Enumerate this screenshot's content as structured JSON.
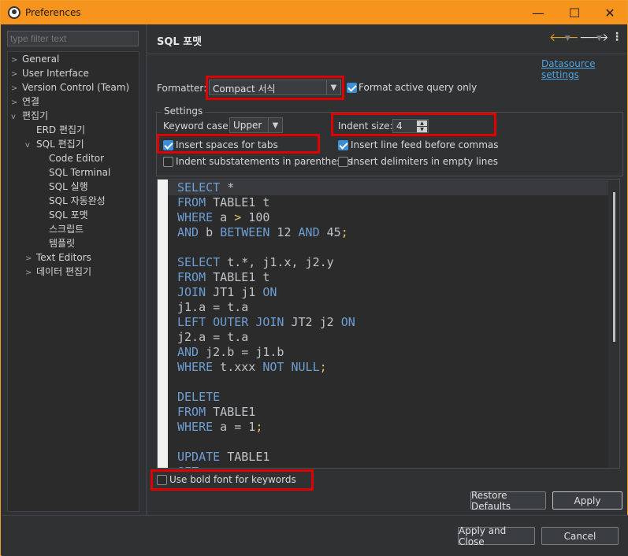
{
  "window": {
    "title": "Preferences",
    "minimize": "—",
    "maximize": "☐",
    "close": "✕"
  },
  "sidebar": {
    "filter_placeholder": "type filter text",
    "items": [
      {
        "label": "General",
        "arrow": ">"
      },
      {
        "label": "User Interface",
        "arrow": ">"
      },
      {
        "label": "Version Control (Team)",
        "arrow": ">"
      },
      {
        "label": "연결",
        "arrow": ">"
      },
      {
        "label": "편집기",
        "arrow": "v"
      },
      {
        "label": "ERD 편집기",
        "arrow": ""
      },
      {
        "label": "SQL 편집기",
        "arrow": "v"
      },
      {
        "label": "Code Editor",
        "arrow": ""
      },
      {
        "label": "SQL Terminal",
        "arrow": ""
      },
      {
        "label": "SQL 실행",
        "arrow": ""
      },
      {
        "label": "SQL 자동완성",
        "arrow": ""
      },
      {
        "label": "SQL 포맷",
        "arrow": ""
      },
      {
        "label": "스크립트",
        "arrow": ""
      },
      {
        "label": "템플릿",
        "arrow": ""
      },
      {
        "label": "Text Editors",
        "arrow": ">"
      },
      {
        "label": "데이터 편집기",
        "arrow": ">"
      }
    ]
  },
  "page": {
    "title": "SQL 포맷",
    "nav_back": "🡐",
    "nav_forward": "🡒",
    "nav_dropdown": "▼",
    "menu": "⋮",
    "datasource_link": "Datasource settings",
    "formatter_label": "Formatter:",
    "formatter_value": "Compact 서식",
    "format_active_label": "Format active query only",
    "settings_title": "Settings",
    "keyword_case_label": "Keyword case:",
    "keyword_case_value": "Upper",
    "indent_size_label": "Indent size:",
    "indent_size_value": "4",
    "insert_spaces_label": "Insert spaces for tabs",
    "insert_linefeed_label": "Insert line feed before commas",
    "indent_sub_label": "Indent substatements in parentheses",
    "insert_delims_label": "Insert delimiters in empty lines",
    "bold_font_label": "Use bold font for keywords",
    "restore_defaults": "Restore Defaults",
    "apply": "Apply"
  },
  "checkboxes": {
    "format_active": true,
    "insert_spaces": true,
    "insert_linefeed": true,
    "indent_sub": false,
    "insert_delims": false,
    "bold_font": false
  },
  "preview_lines": [
    [
      [
        "kw",
        "SELECT"
      ],
      [
        "txt",
        " *"
      ]
    ],
    [
      [
        "kw",
        "FROM"
      ],
      [
        "txt",
        " TABLE1 t"
      ]
    ],
    [
      [
        "kw",
        "WHERE"
      ],
      [
        "txt",
        " a "
      ],
      [
        "op",
        ">"
      ],
      [
        "txt",
        " 100"
      ]
    ],
    [
      [
        "kw",
        "AND"
      ],
      [
        "txt",
        " b "
      ],
      [
        "kw",
        "BETWEEN"
      ],
      [
        "txt",
        " 12 "
      ],
      [
        "kw",
        "AND"
      ],
      [
        "txt",
        " 45"
      ],
      [
        "op",
        ";"
      ]
    ],
    [],
    [
      [
        "kw",
        "SELECT"
      ],
      [
        "txt",
        " t.*, j1.x, j2.y"
      ]
    ],
    [
      [
        "kw",
        "FROM"
      ],
      [
        "txt",
        " TABLE1 t"
      ]
    ],
    [
      [
        "kw",
        "JOIN"
      ],
      [
        "txt",
        " JT1 j1 "
      ],
      [
        "kw",
        "ON"
      ]
    ],
    [
      [
        "txt",
        "j1.a = t.a"
      ]
    ],
    [
      [
        "kw",
        "LEFT OUTER JOIN"
      ],
      [
        "txt",
        " JT2 j2 "
      ],
      [
        "kw",
        "ON"
      ]
    ],
    [
      [
        "txt",
        "j2.a = t.a"
      ]
    ],
    [
      [
        "kw",
        "AND"
      ],
      [
        "txt",
        " j2.b = j1.b"
      ]
    ],
    [
      [
        "kw",
        "WHERE"
      ],
      [
        "txt",
        " t.xxx "
      ],
      [
        "kw",
        "NOT NULL"
      ],
      [
        "op",
        ";"
      ]
    ],
    [],
    [
      [
        "kw",
        "DELETE"
      ]
    ],
    [
      [
        "kw",
        "FROM"
      ],
      [
        "txt",
        " TABLE1"
      ]
    ],
    [
      [
        "kw",
        "WHERE"
      ],
      [
        "txt",
        " a = 1"
      ],
      [
        "op",
        ";"
      ]
    ],
    [],
    [
      [
        "kw",
        "UPDATE"
      ],
      [
        "txt",
        " TABLE1"
      ]
    ],
    [
      [
        "kw",
        "SET"
      ]
    ]
  ],
  "footer": {
    "apply_close": "Apply and Close",
    "cancel": "Cancel"
  },
  "colors": {
    "accent": "#f7941d",
    "highlight": "#e00000",
    "keyword": "#6d9fd4",
    "checkbox": "#3c8fd6"
  }
}
